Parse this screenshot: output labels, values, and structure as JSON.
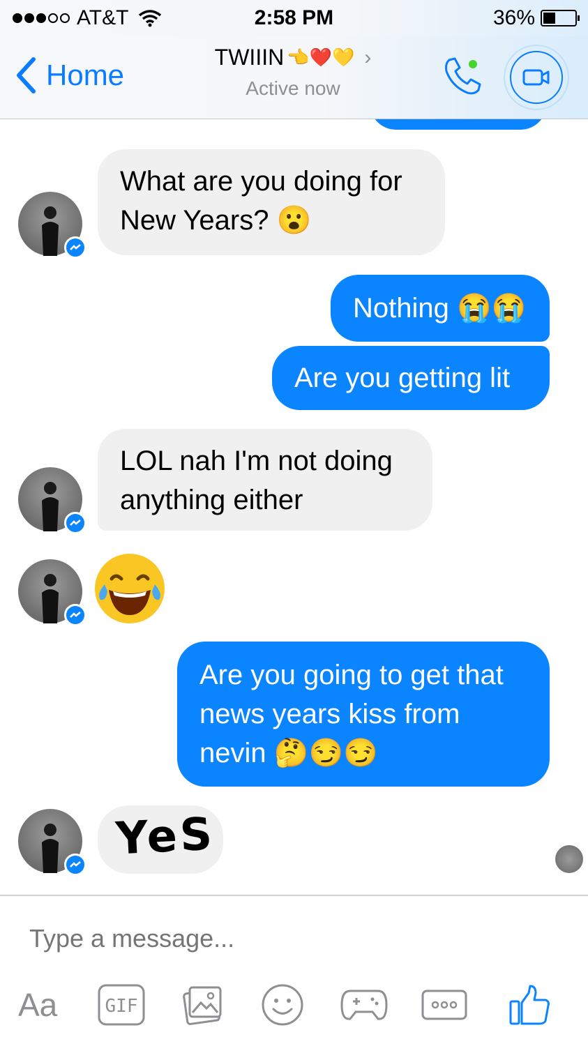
{
  "status_bar": {
    "carrier": "AT&T",
    "time": "2:58 PM",
    "battery": "36%",
    "battery_level": 0.36
  },
  "header": {
    "back_label": "Home",
    "title": "TWIIIN",
    "title_emojis": "👈❤️💛",
    "status": "Active now"
  },
  "messages": {
    "m1_line1": "What are you doing for",
    "m1_line2": "New Years? 😮",
    "m2": "Nothing 😭😭",
    "m3": "Are you getting lit",
    "m4_line1": "LOL nah I'm not doing",
    "m4_line2": "anything either",
    "m5_emoji": "😂",
    "m6_line1": "Are you going to get that",
    "m6_line2": "news years kiss from",
    "m6_line3": "nevin 🤔😏😏",
    "m7_drawing": "YeS"
  },
  "composer": {
    "placeholder": "Type a message...",
    "aa_label": "Aa",
    "gif_label": "GIF"
  },
  "colors": {
    "accent": "#0a84ff",
    "incoming_bubble": "#f1f0f0",
    "placeholder": "#c7c7cc"
  },
  "icons": [
    "back-chevron-icon",
    "phone-icon",
    "video-camera-icon",
    "messenger-badge-icon",
    "gif-icon",
    "photo-icon",
    "smiley-icon",
    "game-controller-icon",
    "more-icon",
    "thumbs-up-icon"
  ]
}
